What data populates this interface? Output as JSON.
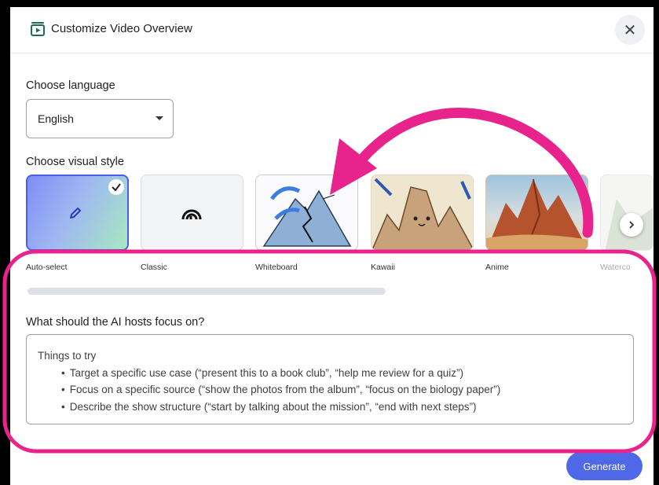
{
  "dialog": {
    "title": "Customize Video Overview",
    "close_icon": "close-icon",
    "title_icon": "video-overview-icon"
  },
  "language": {
    "label": "Choose language",
    "selected": "English"
  },
  "visual_style": {
    "label": "Choose visual style",
    "items": [
      {
        "label": "Auto-select",
        "selected": true
      },
      {
        "label": "Classic"
      },
      {
        "label": "Whiteboard"
      },
      {
        "label": "Kawaii"
      },
      {
        "label": "Anime"
      },
      {
        "label": "Waterco"
      }
    ]
  },
  "focus": {
    "label": "What should the AI hosts focus on?",
    "intro": "Things to try",
    "tips": [
      "Target a specific use case (“present this to a book club”, “help me review for a quiz”)",
      "Focus on a specific source (“show the photos from the album”, “focus on the biology paper”)",
      "Describe the show structure (“start by talking about the mission”, “end with next steps”)"
    ]
  },
  "actions": {
    "generate": "Generate"
  },
  "colors": {
    "accent": "#4e68e8",
    "annotation": "#e8248c"
  }
}
